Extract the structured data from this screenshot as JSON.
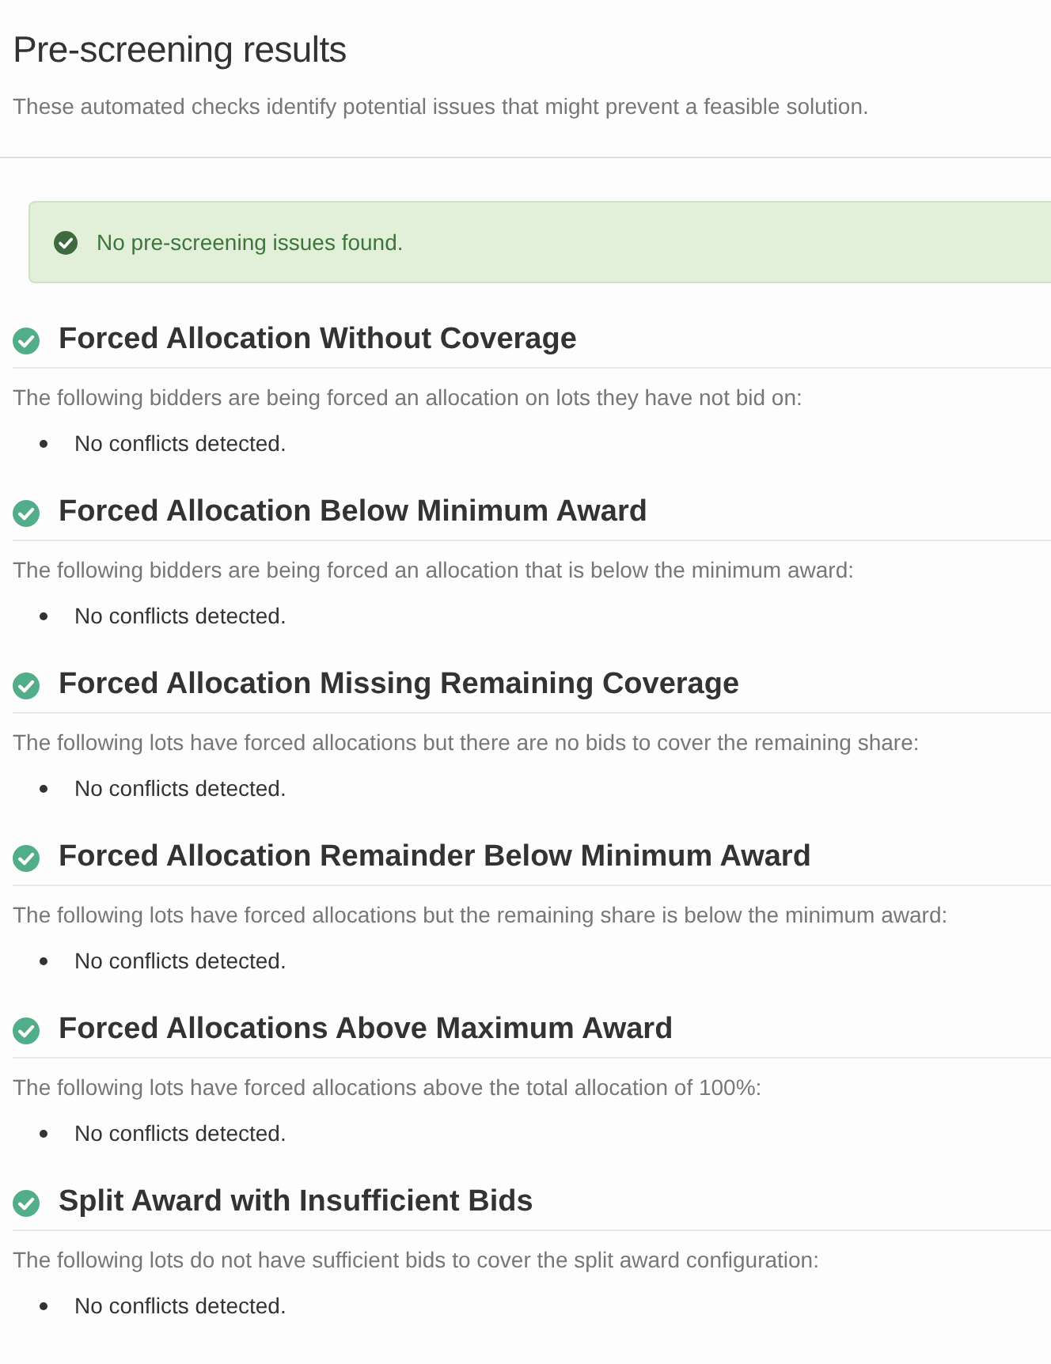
{
  "header": {
    "title": "Pre-screening results",
    "subtitle": "These automated checks identify potential issues that might prevent a feasible solution."
  },
  "alert": {
    "kind": "success",
    "message": "No pre-screening issues found."
  },
  "checks": [
    {
      "passed": true,
      "title": "Forced Allocation Without Coverage",
      "description": "The following bidders are being forced an allocation on lots they have not bid on:",
      "items": [
        "No conflicts detected."
      ]
    },
    {
      "passed": true,
      "title": "Forced Allocation Below Minimum Award",
      "description": "The following bidders are being forced an allocation that is below the minimum award:",
      "items": [
        "No conflicts detected."
      ]
    },
    {
      "passed": true,
      "title": "Forced Allocation Missing Remaining Coverage",
      "description": "The following lots have forced allocations but there are no bids to cover the remaining share:",
      "items": [
        "No conflicts detected."
      ]
    },
    {
      "passed": true,
      "title": "Forced Allocation Remainder Below Minimum Award",
      "description": "The following lots have forced allocations but the remaining share is below the minimum award:",
      "items": [
        "No conflicts detected."
      ]
    },
    {
      "passed": true,
      "title": "Forced Allocations Above Maximum Award",
      "description": "The following lots have forced allocations above the total allocation of 100%:",
      "items": [
        "No conflicts detected."
      ]
    },
    {
      "passed": true,
      "title": "Split Award with Insufficient Bids",
      "description": "The following lots do not have sufficient bids to cover the split award configuration:",
      "items": [
        "No conflicts detected."
      ]
    }
  ]
}
